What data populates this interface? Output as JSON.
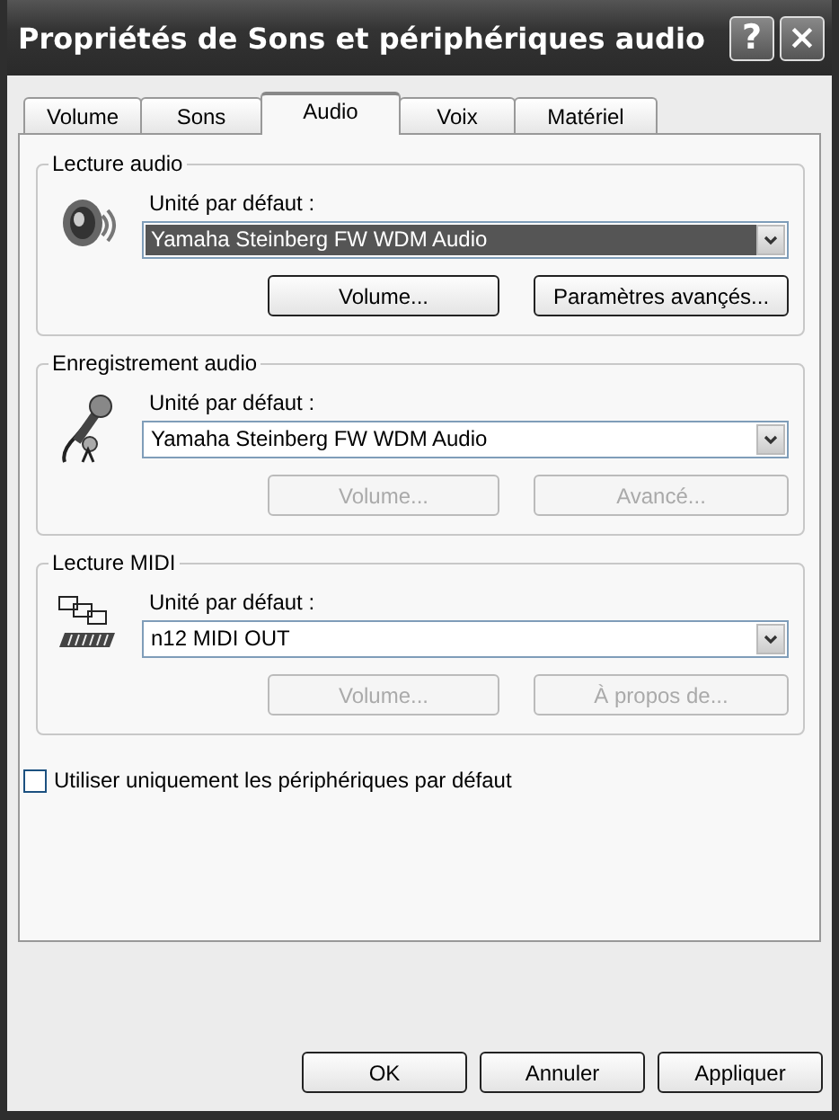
{
  "window": {
    "title": "Propriétés de Sons et périphériques audio",
    "help_button": "?",
    "close_button": "×"
  },
  "tabs": [
    {
      "label": "Volume",
      "selected": false
    },
    {
      "label": "Sons",
      "selected": false
    },
    {
      "label": "Audio",
      "selected": true
    },
    {
      "label": "Voix",
      "selected": false
    },
    {
      "label": "Matériel",
      "selected": false
    }
  ],
  "groups": [
    {
      "kind": "speaker",
      "title": "Lecture audio",
      "field_label": "Unité par défaut :",
      "device": {
        "value": "Yamaha Steinberg FW WDM Audio",
        "selected": true
      },
      "buttons": [
        {
          "label": "Volume...",
          "disabled": false
        },
        {
          "label": "Paramètres avançés...",
          "disabled": false
        }
      ]
    },
    {
      "kind": "microphone",
      "title": "Enregistrement audio",
      "field_label": "Unité par défaut :",
      "device": {
        "value": "Yamaha Steinberg FW WDM Audio",
        "selected": false
      },
      "buttons": [
        {
          "label": "Volume...",
          "disabled": true
        },
        {
          "label": "Avancé...",
          "disabled": true
        }
      ]
    },
    {
      "kind": "midi",
      "title": "Lecture MIDI",
      "field_label": "Unité par défaut :",
      "device": {
        "value": "n12 MIDI OUT",
        "selected": false
      },
      "buttons": [
        {
          "label": "Volume...",
          "disabled": true
        },
        {
          "label": "À propos de...",
          "disabled": true
        }
      ]
    }
  ],
  "default_only": {
    "label": "Utiliser uniquement les périphériques par défaut",
    "checked": false
  },
  "footer_buttons": [
    {
      "label": "OK",
      "disabled": false
    },
    {
      "label": "Annuler",
      "disabled": false
    },
    {
      "label": "Appliquer",
      "disabled": false
    }
  ]
}
